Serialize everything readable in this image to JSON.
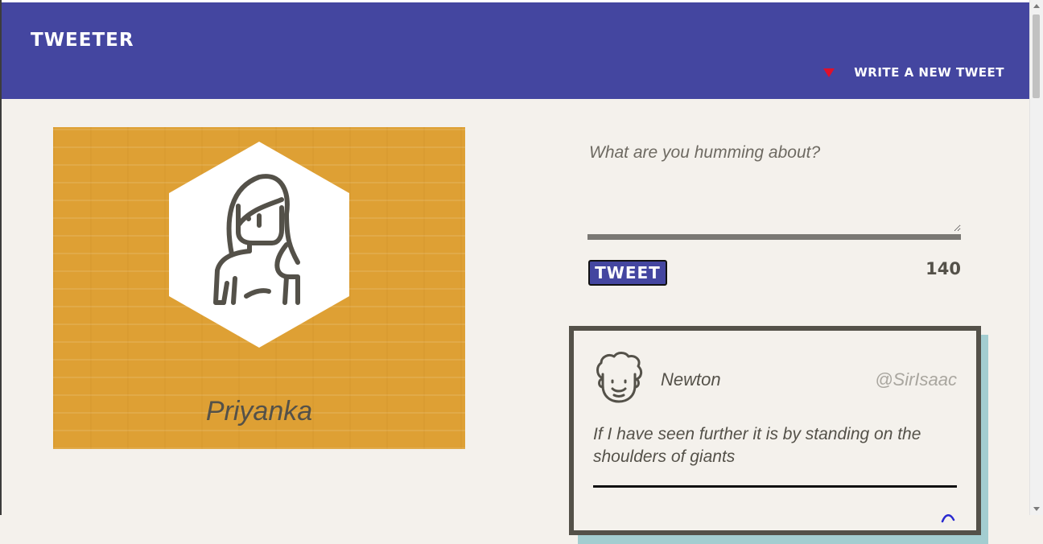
{
  "app": {
    "title": "Tweeter"
  },
  "header": {
    "compose_toggle_label": "Write a new tweet",
    "toggle_icon": "caret-down-icon",
    "toggle_color": "#e0102a",
    "bar_color": "#4446a0"
  },
  "profile": {
    "name": "Priyanka",
    "avatar_icon": "user-avatar-icon",
    "background_color": "#dea034"
  },
  "compose": {
    "placeholder": "What are you humming about?",
    "value": "",
    "button_label": "Tweet",
    "char_count": "140"
  },
  "tweets": [
    {
      "author": "Newton",
      "handle": "@SirIsaac",
      "content": "If I have seen further it is by standing on the shoulders of giants",
      "avatar_icon": "newton-avatar-icon"
    }
  ]
}
